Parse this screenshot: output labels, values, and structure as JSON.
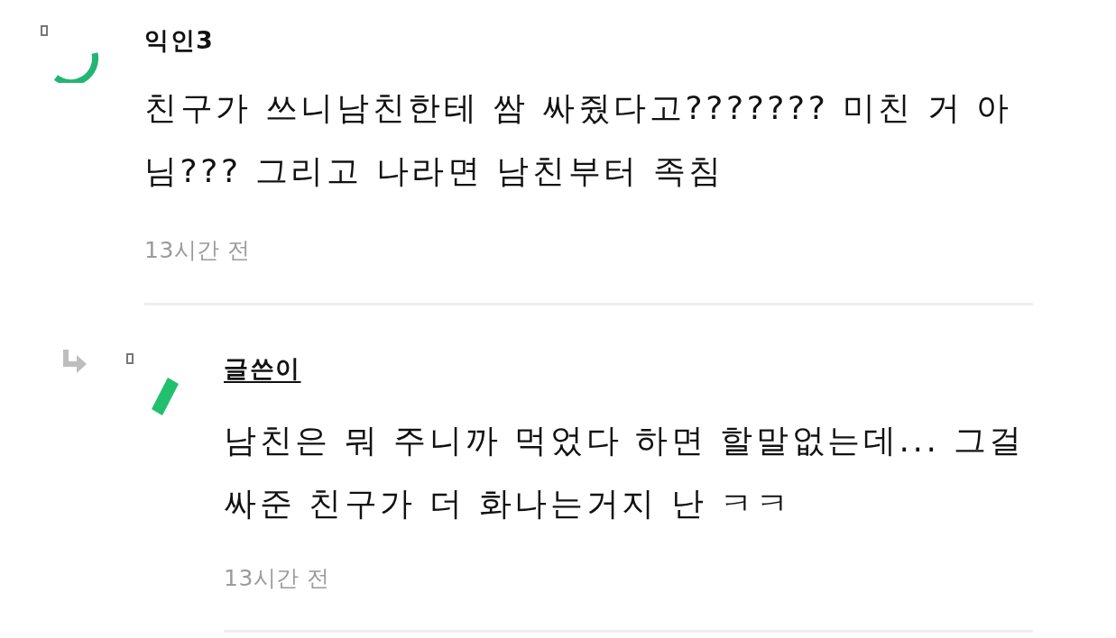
{
  "comments": [
    {
      "kind": "comment",
      "author": "익인3",
      "underlined": false,
      "text": "친구가 쓰니남친한테 쌈 싸줬다고??????? 미친 거 아님??? 그리고 나라면 남친부터 족침",
      "time": "13시간 전"
    },
    {
      "kind": "reply",
      "author": "글쓴이",
      "underlined": true,
      "text": "남친은 뭐 주니까 먹었다 하면 할말없는데... 그걸 싸준 친구가 더 화나는거지 난 ㅋㅋ",
      "time": "13시간 전"
    }
  ]
}
